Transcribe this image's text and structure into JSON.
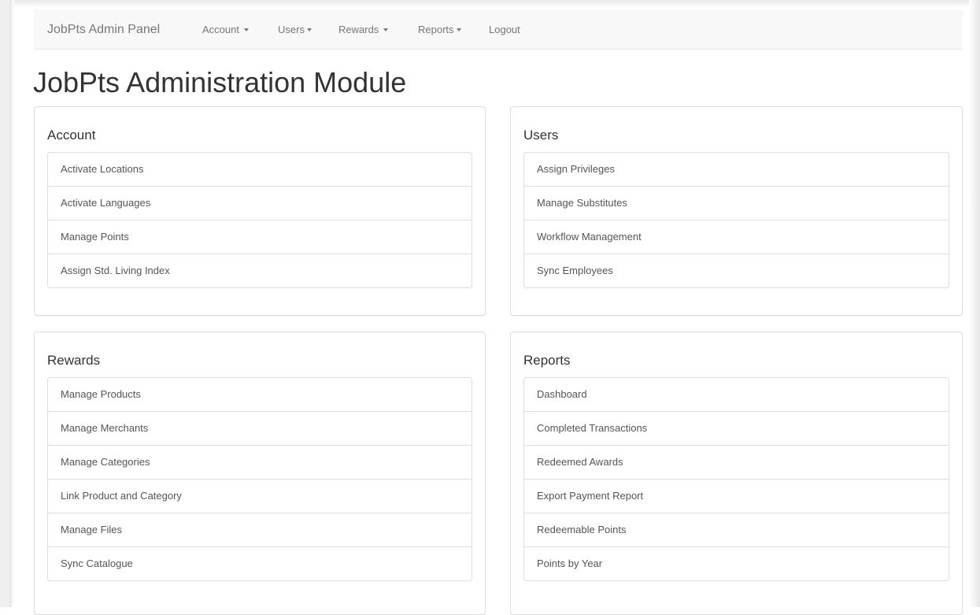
{
  "navbar": {
    "brand": "JobPts Admin Panel",
    "items": [
      {
        "label": "Account"
      },
      {
        "label": "Users"
      },
      {
        "label": "Rewards"
      },
      {
        "label": "Reports"
      },
      {
        "label": "Logout"
      }
    ]
  },
  "page": {
    "title": "JobPts Administration Module"
  },
  "panels": {
    "account": {
      "title": "Account",
      "items": [
        "Activate Locations",
        "Activate Languages",
        "Manage Points",
        "Assign Std. Living Index"
      ]
    },
    "users": {
      "title": "Users",
      "items": [
        "Assign Privileges",
        "Manage Substitutes",
        "Workflow Management",
        "Sync Employees"
      ]
    },
    "rewards": {
      "title": "Rewards",
      "items": [
        "Manage Products",
        "Manage Merchants",
        "Manage Categories",
        "Link Product and Category",
        "Manage Files",
        "Sync Catalogue"
      ]
    },
    "reports": {
      "title": "Reports",
      "items": [
        "Dashboard",
        "Completed Transactions",
        "Redeemed Awards",
        "Export Payment Report",
        "Redeemable Points",
        "Points by Year"
      ]
    }
  }
}
